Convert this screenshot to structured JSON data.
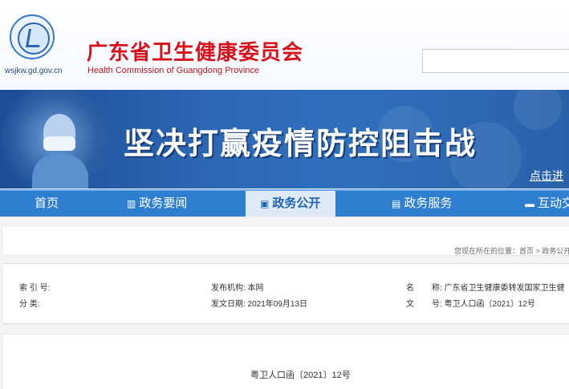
{
  "header": {
    "domain": "wsjkw.gd.gov.cn",
    "title_cn": "广东省卫生健康委员会",
    "title_en": "Health Commission of Guangdong Province"
  },
  "banner": {
    "slogan": "坚决打赢疫情防控阻击战",
    "link": "点击进"
  },
  "nav": {
    "items": [
      {
        "label": "首页",
        "icon": ""
      },
      {
        "label": "政务要闻",
        "icon": "news-icon"
      },
      {
        "label": "政务公开",
        "icon": "document-icon"
      },
      {
        "label": "政务服务",
        "icon": "clipboard-icon"
      },
      {
        "label": "互动交",
        "icon": "chat-icon"
      }
    ],
    "active_index": 2
  },
  "breadcrumb": {
    "text": "您现在所在的位置：首页 > 政务公开"
  },
  "meta": {
    "index_label": "索 引 号:",
    "category_label": "分 类:",
    "publisher": "发布机构: 本网",
    "date": "发文日期: 2021年09月13日",
    "name_label": "名",
    "name_value": "称: 广东省卫生健康委转发国家卫生健",
    "doc_label": "文",
    "doc_value": "号: 粤卫人口函〔2021〕12号"
  },
  "document": {
    "number": "粤卫人口函〔2021〕12号"
  },
  "colors": {
    "title_red": "#d6131c",
    "nav_blue": "#2f7fd0",
    "active_tab_bg": "#dfeaf7"
  }
}
